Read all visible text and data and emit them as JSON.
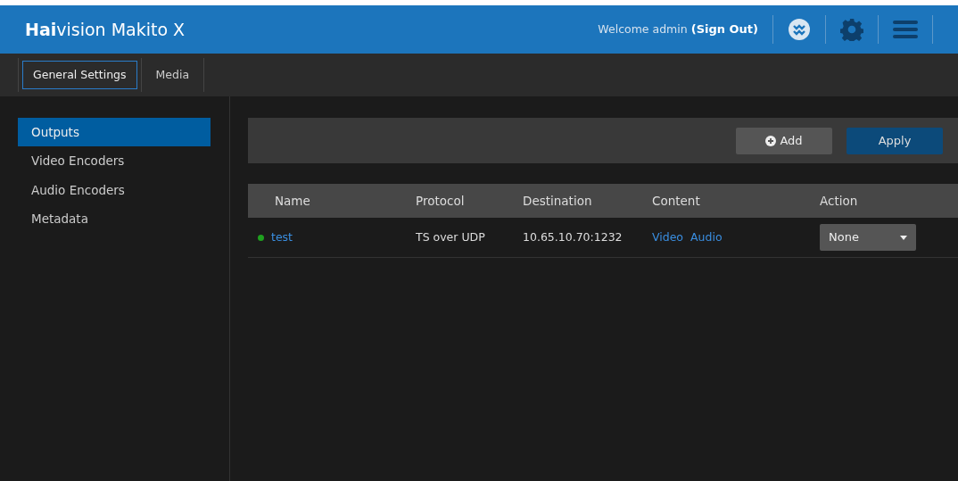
{
  "header": {
    "brand_bold": "Hai",
    "brand_rest": "vision Makito X",
    "welcome": "Welcome admin",
    "sign_out": "(Sign Out)"
  },
  "tabs": [
    {
      "label": "General Settings",
      "selected": true
    },
    {
      "label": "Media",
      "selected": false
    }
  ],
  "sidebar": {
    "items": [
      {
        "label": "Outputs",
        "selected": true
      },
      {
        "label": "Video Encoders",
        "selected": false
      },
      {
        "label": "Audio Encoders",
        "selected": false
      },
      {
        "label": "Metadata",
        "selected": false
      }
    ]
  },
  "toolbar": {
    "add": "Add",
    "apply": "Apply"
  },
  "table": {
    "columns": [
      "Name",
      "Protocol",
      "Destination",
      "Content",
      "Action"
    ],
    "rows": [
      {
        "color": "#1fa01f",
        "name": "test",
        "protocol": "TS over UDP",
        "destination": "10.65.10.70:1232",
        "content": [
          "Video",
          "Audio"
        ],
        "action": "None"
      }
    ]
  }
}
